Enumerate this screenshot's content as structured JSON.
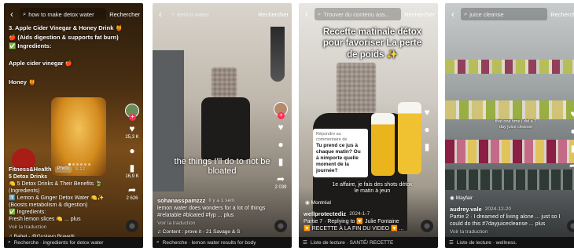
{
  "panels": [
    {
      "search_query": "how to make detox water",
      "search_button": "Rechercher",
      "overlay_lines": [
        "3. Apple Cider Vinegar & Honey Drink 🍯",
        "🍎 (Aids digestion & supports fat burn)",
        "✅ Ingredients:",
        "Apple cider vinegar 🍎",
        "Honey 🍯"
      ],
      "likes": "25,3 K",
      "comments": "",
      "saves": "16,9 K",
      "shares": "2 626",
      "user": "Fitness&Health",
      "tag": "Photo",
      "date": "3-12",
      "desc_title": "5 Detox Drinks",
      "desc_lines": [
        "🍋 5 Detox Drinks & Their Benefits 🍃(Ingredients)",
        "1️⃣ Lemon & Ginger Detox Water 🍋✨",
        "(Boosts metabolism & digestion)",
        "✅ Ingredients:",
        "Fresh lemon slices 🍋 ... plus"
      ],
      "translate": "Voir la traduction",
      "music": "♫ Babel - @Gustavo Bravetti",
      "bottom_search": "Recherche · ingredients for detox water"
    },
    {
      "search_query": "lemon water",
      "search_button": "Rechercher",
      "overlay": "the things I'll do to not be bloated",
      "likes": "",
      "comments": "",
      "saves": "",
      "shares": "2 039",
      "user": "sohanasspamzzz",
      "date": "Il y a 1 sem",
      "desc_lines": [
        "lemon water does wonders for a lot of things #relatable #bloated #fyp ... plus"
      ],
      "translate": "Voir la traduction",
      "music": "♫ Content : prove it - 21 Savage & S",
      "bottom_search": "Recherche · lemon water results for body"
    },
    {
      "search_query": "Trouver du contenu ass...",
      "search_button": "Rechercher",
      "overlay": "Recette matinale détox pour favoriser La perte de poids ✨",
      "card_line1": "Répondre au commentaire de",
      "card_text": "Tu prend ce jus à chaque matin? Ou à nimporte quelle moment de la journée?",
      "caption_overlay": "1e affaire, je fais des shots détox le matin à jeun",
      "location": "Montréal",
      "likes": "",
      "comments": "",
      "saves": "",
      "shares": "",
      "user": "wellprotectediz",
      "date": "2024-1-7",
      "desc_lines": [
        "Partie 7 · Replying to 🔽 Julie Fontaine",
        "🔽 RECETTE À LA FIN DU VIDEO 🔽 ..."
      ],
      "translate": "",
      "music": "",
      "bottom_search": "Liste de lecture · SANTÉ/ RECETTE"
    },
    {
      "search_query": "juice cleanse",
      "search_button": "Rechercher",
      "overlay_small": "that one time i did a 7 day juice cleanse",
      "location": "Mayfair",
      "likes": "",
      "comments": "",
      "saves": "",
      "shares": "",
      "user": "audrey.vale",
      "date": "2024-12-20",
      "desc_lines": [
        "Partie 2 · I dreamed of living alone ... just so I could do this #7dayjuicecleanse ... plus"
      ],
      "translate": "Voir la traduction",
      "music": "",
      "bottom_search": "Liste de lecture · wellness."
    }
  ]
}
